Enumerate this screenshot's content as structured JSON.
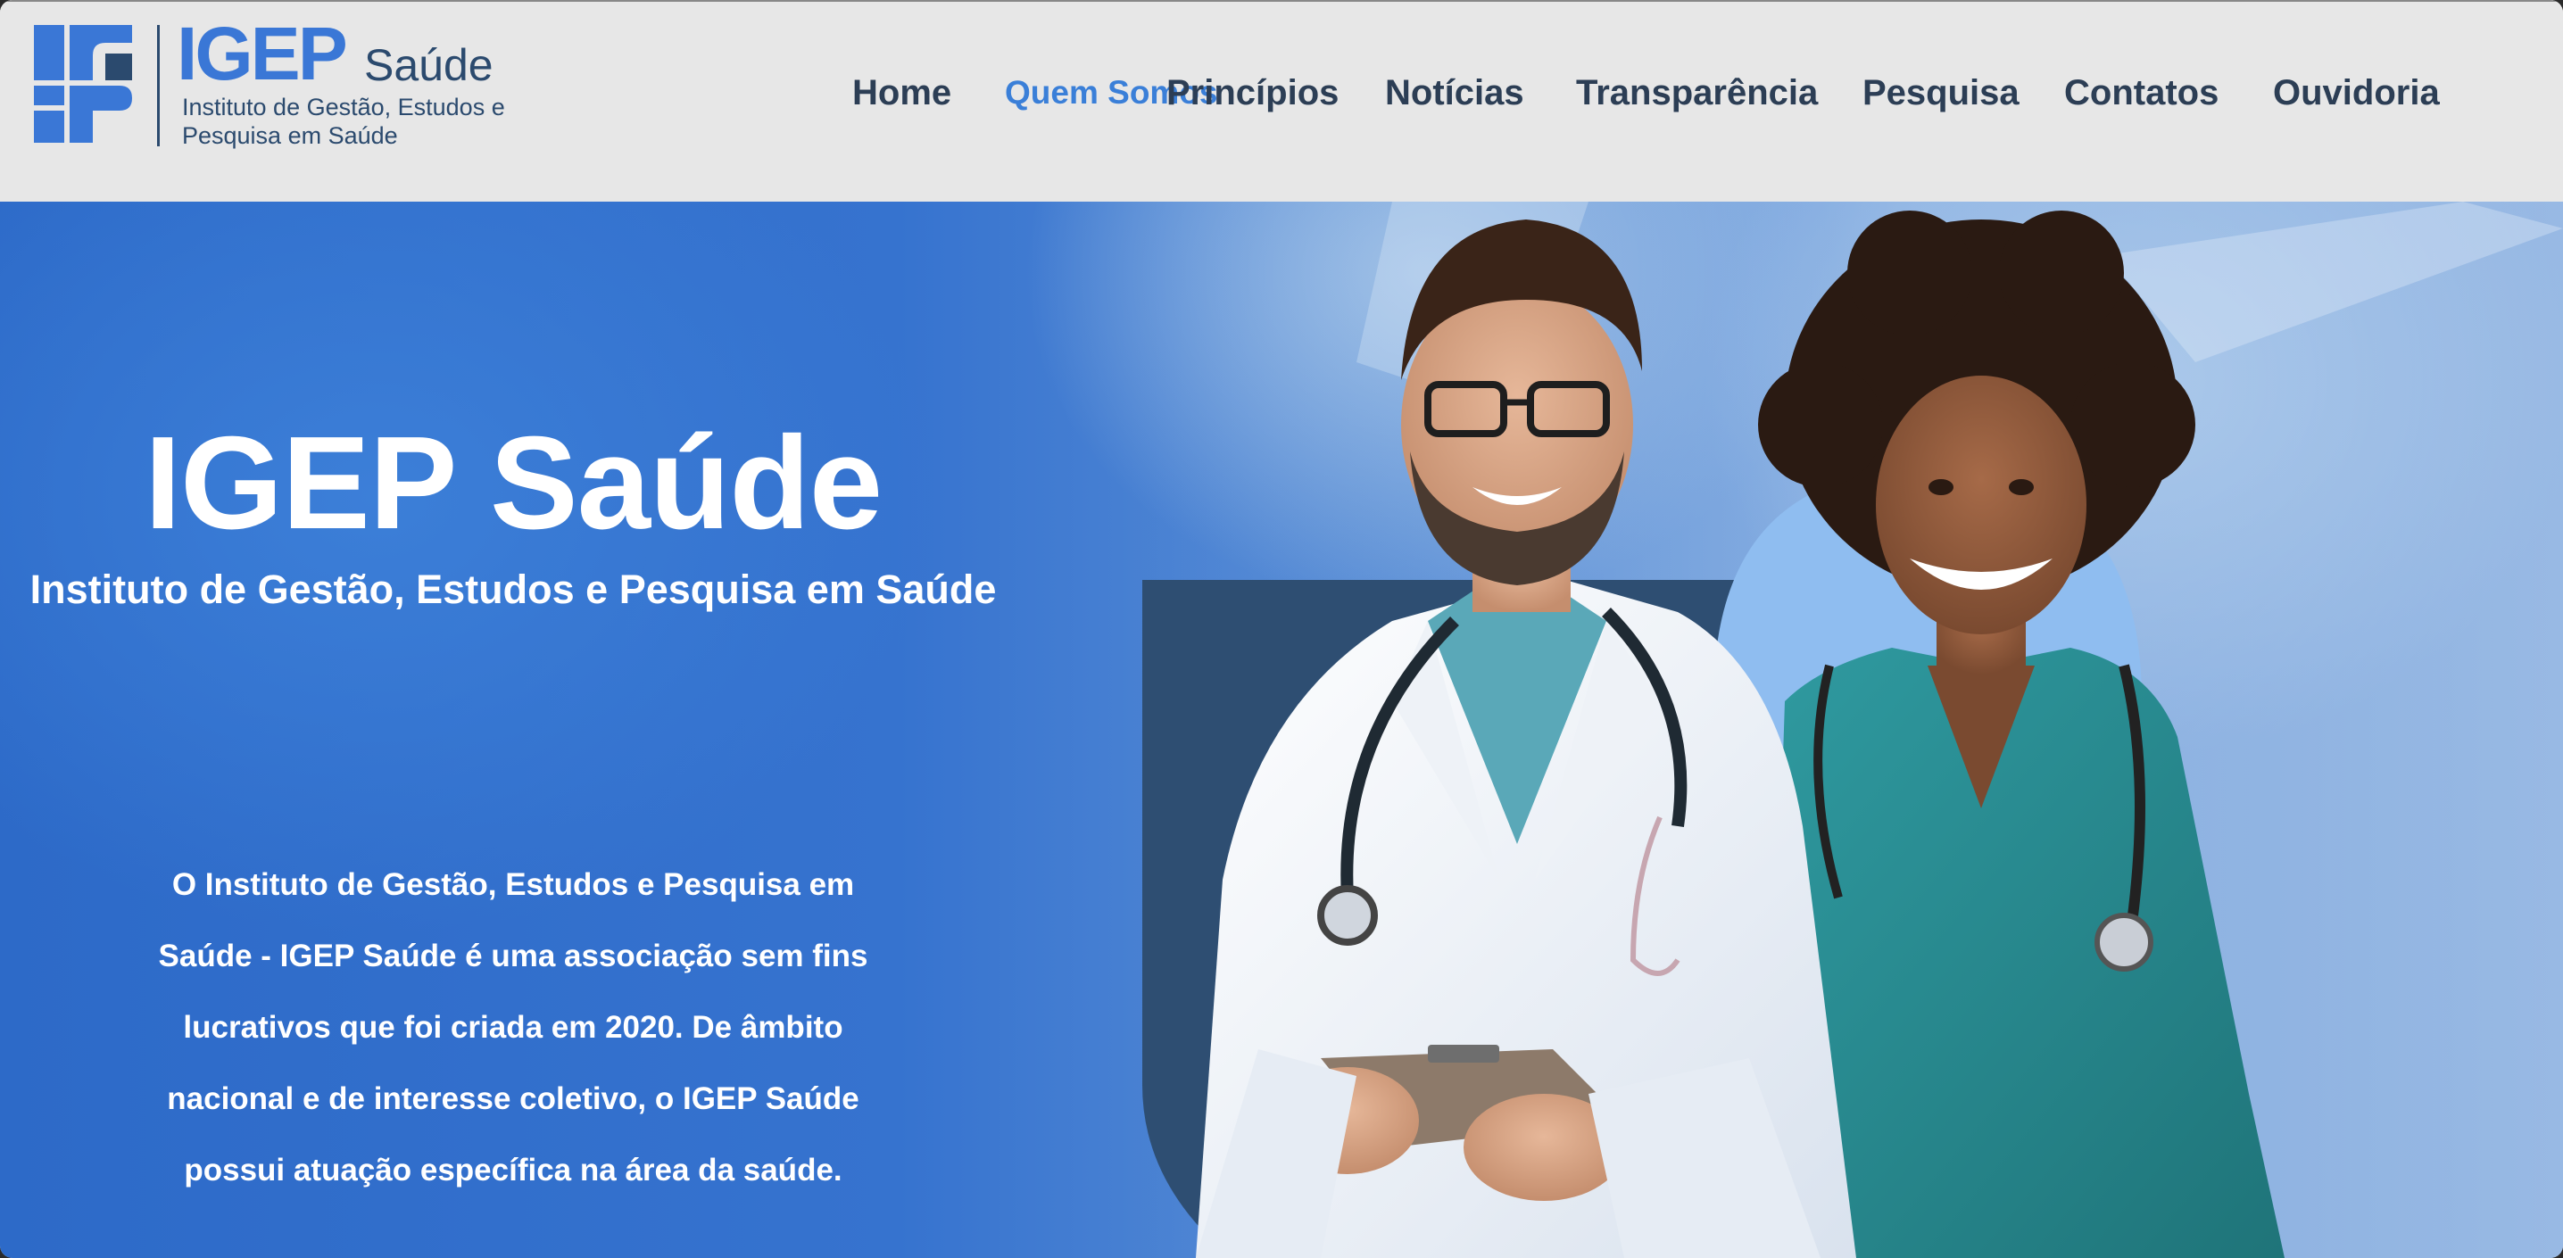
{
  "logo": {
    "word": "IGEP",
    "suffix": "Saúde",
    "subtitle": "Instituto de Gestão, Estudos e Pesquisa em Saúde"
  },
  "nav": {
    "items": [
      {
        "label": "Home"
      },
      {
        "label": "Quem Somos",
        "active": true
      },
      {
        "label": "Princípios"
      },
      {
        "label": "Notícias"
      },
      {
        "label": "Transparência"
      },
      {
        "label": "Pesquisa"
      },
      {
        "label": "Contatos"
      },
      {
        "label": "Ouvidoria"
      }
    ]
  },
  "hero": {
    "title": "IGEP Saúde",
    "subtitle": "Instituto de Gestão, Estudos e Pesquisa em Saúde",
    "description": "O Instituto de Gestão, Estudos e Pesquisa em Saúde - IGEP Saúde é uma associação sem fins lucrativos que foi criada em 2020. De âmbito nacional e de interesse coletivo, o IGEP Saúde possui atuação específica na área da saúde."
  },
  "colors": {
    "brand_blue": "#3a77d6",
    "brand_navy": "#2b4a6e",
    "nav_text": "#2c3e55",
    "nav_active": "#3a7fd8",
    "header_bg": "#e7e7e7",
    "hero_blue": "#3673cf"
  },
  "icons": {
    "logo_mark": "igep-logo-mark"
  }
}
